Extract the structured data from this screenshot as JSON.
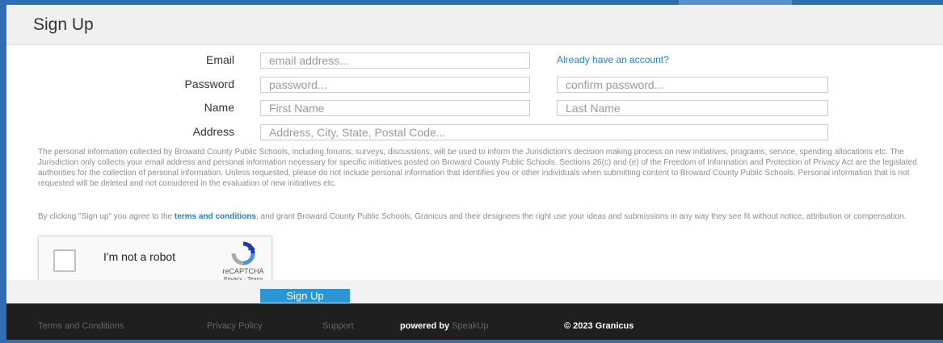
{
  "form": {
    "title": "Sign Up",
    "email_label": "Email",
    "email_placeholder": "email address...",
    "already_account_link": "Already have an account?",
    "password_label": "Password",
    "password_placeholder": "password...",
    "confirm_password_placeholder": "confirm password...",
    "name_label": "Name",
    "first_name_placeholder": "First Name",
    "last_name_placeholder": "Last Name",
    "address_label": "Address",
    "address_placeholder": "Address, City, State, Postal Code...",
    "disclaimer": "The personal information collected by Broward County Public Schools, including forums, surveys, discussions, will be used to inform the Jurisdiction's decision making process on new initiatives, programs, service, spending allocations etc. The Jurisdiction only collects your email address and personal information necessary for specific initiatives posted on Broward County Public Schools. Sections 26(c) and (e) of the Freedom of Information and Protection of Privacy Act are the legislated authorities for the collection of personal information. Unless requested, please do not include personal information that identifies you or other individuals when submitting content to Broward County Public Schools. Personal information that is not requested will be deleted and not considered in the evaluation of new initiatives etc.",
    "consent_prefix": "By clicking \"Sign up\" you agree to the ",
    "terms_link": "terms and conditions",
    "consent_suffix": ", and grant Broward County Public Schools, Granicus and their designees the right use your ideas and submissions in any way they see fit without notice, attribution or compensation.",
    "submit_label": "Sign Up"
  },
  "captcha": {
    "label": "I'm not a robot",
    "brand": "reCAPTCHA",
    "privacy": "Privacy",
    "separator": " - ",
    "terms": "Terms"
  },
  "footer": {
    "terms": "Terms and Conditions",
    "privacy": "Privacy Policy",
    "support": "Support",
    "powered_prefix": "powered by ",
    "powered_brand": "SpeakUp",
    "copyright": "© 2023 Granicus"
  },
  "colors": {
    "accent": "#2a96d8",
    "link": "#2c7fc2",
    "footer_bg": "#1f1f1f",
    "page_bg": "#2f6db5"
  }
}
